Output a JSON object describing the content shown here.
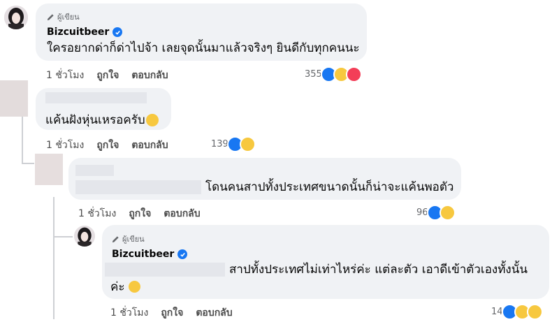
{
  "comments": [
    {
      "badge": "ผู้เขียน",
      "author": "Bizcuitbeer",
      "text": "ใครอยากด่าก็ด่าไปจ้า เลยจุดนั้นมาแล้วจริงๆ ยินดีกับทุกคนนะ",
      "time": "1 ชั่วโมง",
      "like_label": "ถูกใจ",
      "reply_label": "ตอบกลับ",
      "reaction_count": "355",
      "reactions": [
        "like-icon",
        "haha-icon",
        "love-icon"
      ]
    },
    {
      "text": "แค้นฝังหุ่นเหรอครับ",
      "time": "1 ชั่วโมง",
      "like_label": "ถูกใจ",
      "reply_label": "ตอบกลับ",
      "reaction_count": "139",
      "reactions": [
        "like-icon",
        "haha-icon"
      ]
    },
    {
      "text": "โดนคนสาปทั้งประเทศขนาดนั้นก็น่าจะแค้นพอตัว",
      "time": "1 ชั่วโมง",
      "like_label": "ถูกใจ",
      "reply_label": "ตอบกลับ",
      "reaction_count": "96",
      "reactions": [
        "like-icon",
        "haha-icon"
      ]
    },
    {
      "badge": "ผู้เขียน",
      "author": "Bizcuitbeer",
      "text_line1": "สาปทั้งประเทศไม่เท่าไหร่ค่ะ แต่ละตัว เอาดีเข้าตัวเองทั้งนั้น",
      "text_line2": "ค่ะ",
      "time": "1 ชั่วโมง",
      "like_label": "ถูกใจ",
      "reply_label": "ตอบกลับ",
      "reaction_count": "14",
      "reactions": [
        "like-icon",
        "haha-icon",
        "wow-icon"
      ]
    }
  ],
  "colors": {
    "verified": "#1877f2",
    "bubble": "#f0f2f5",
    "like": "#1877f2",
    "love": "#f33e58",
    "haha": "#f7c83f"
  }
}
